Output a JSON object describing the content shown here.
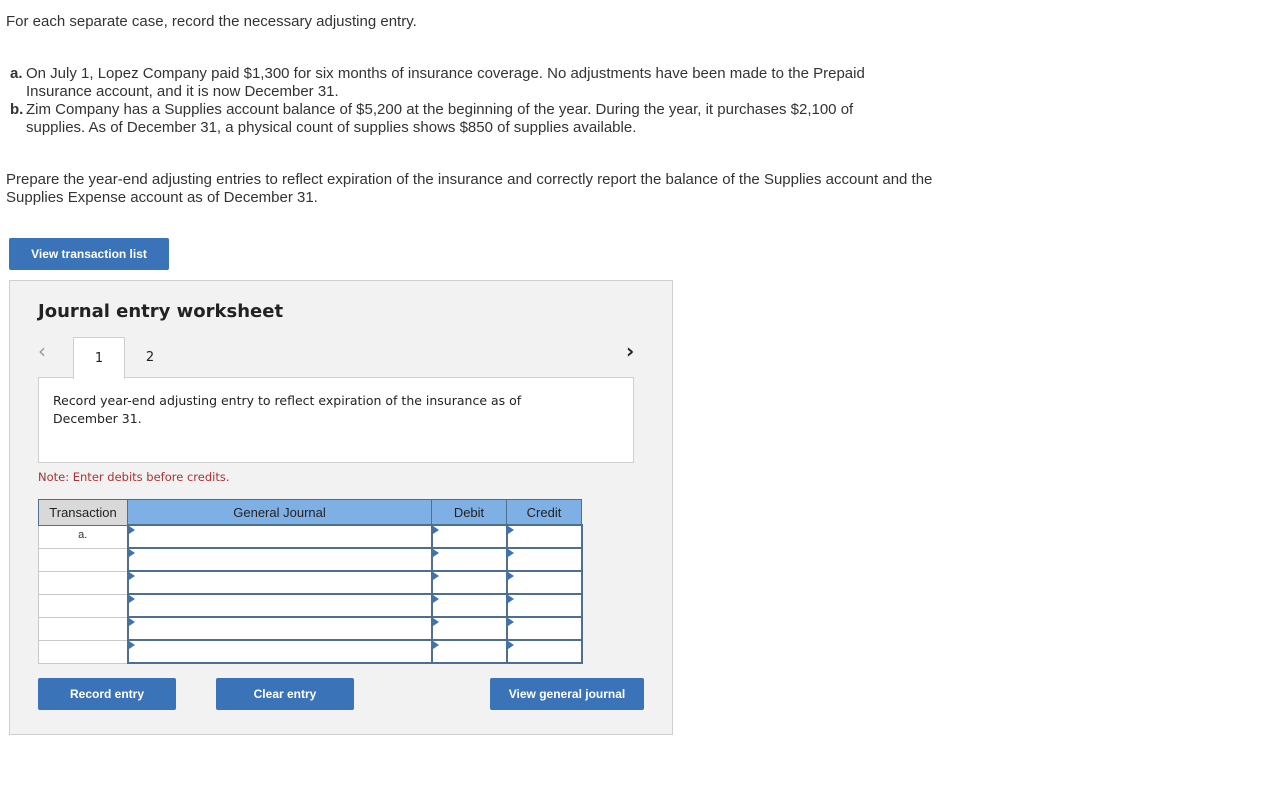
{
  "intro": "For each separate case, record the necessary adjusting entry.",
  "cases": [
    {
      "letter": "a.",
      "text": "On July 1, Lopez Company paid $1,300 for six months of insurance coverage. No adjustments have been made to the Prepaid Insurance account, and it is now December 31."
    },
    {
      "letter": "b.",
      "text": "Zim Company has a Supplies account balance of $5,200 at the beginning of the year. During the year, it purchases $2,100 of supplies. As of December 31, a physical count of supplies shows $850 of supplies available."
    }
  ],
  "instructions": "Prepare the year-end adjusting entries to reflect expiration of the insurance and correctly report the balance of the Supplies account and the Supplies Expense account as of December 31.",
  "buttons": {
    "view_transaction_list": "View transaction list",
    "record_entry": "Record entry",
    "clear_entry": "Clear entry",
    "view_general_journal": "View general journal"
  },
  "worksheet": {
    "title": "Journal entry worksheet",
    "tabs": [
      "1",
      "2"
    ],
    "active_tab": "1",
    "prompt": "Record year-end adjusting entry to reflect expiration of the insurance as of December 31.",
    "note": "Note: Enter debits before credits.",
    "columns": {
      "transaction": "Transaction",
      "general_journal": "General Journal",
      "debit": "Debit",
      "credit": "Credit"
    },
    "rows": [
      {
        "transaction": "a.",
        "account": "",
        "debit": "",
        "credit": ""
      },
      {
        "transaction": "",
        "account": "",
        "debit": "",
        "credit": ""
      },
      {
        "transaction": "",
        "account": "",
        "debit": "",
        "credit": ""
      },
      {
        "transaction": "",
        "account": "",
        "debit": "",
        "credit": ""
      },
      {
        "transaction": "",
        "account": "",
        "debit": "",
        "credit": ""
      },
      {
        "transaction": "",
        "account": "",
        "debit": "",
        "credit": ""
      }
    ]
  },
  "colors": {
    "button": "#3b73b9",
    "table_header": "#7eb0e6",
    "note": "#aa3333"
  }
}
